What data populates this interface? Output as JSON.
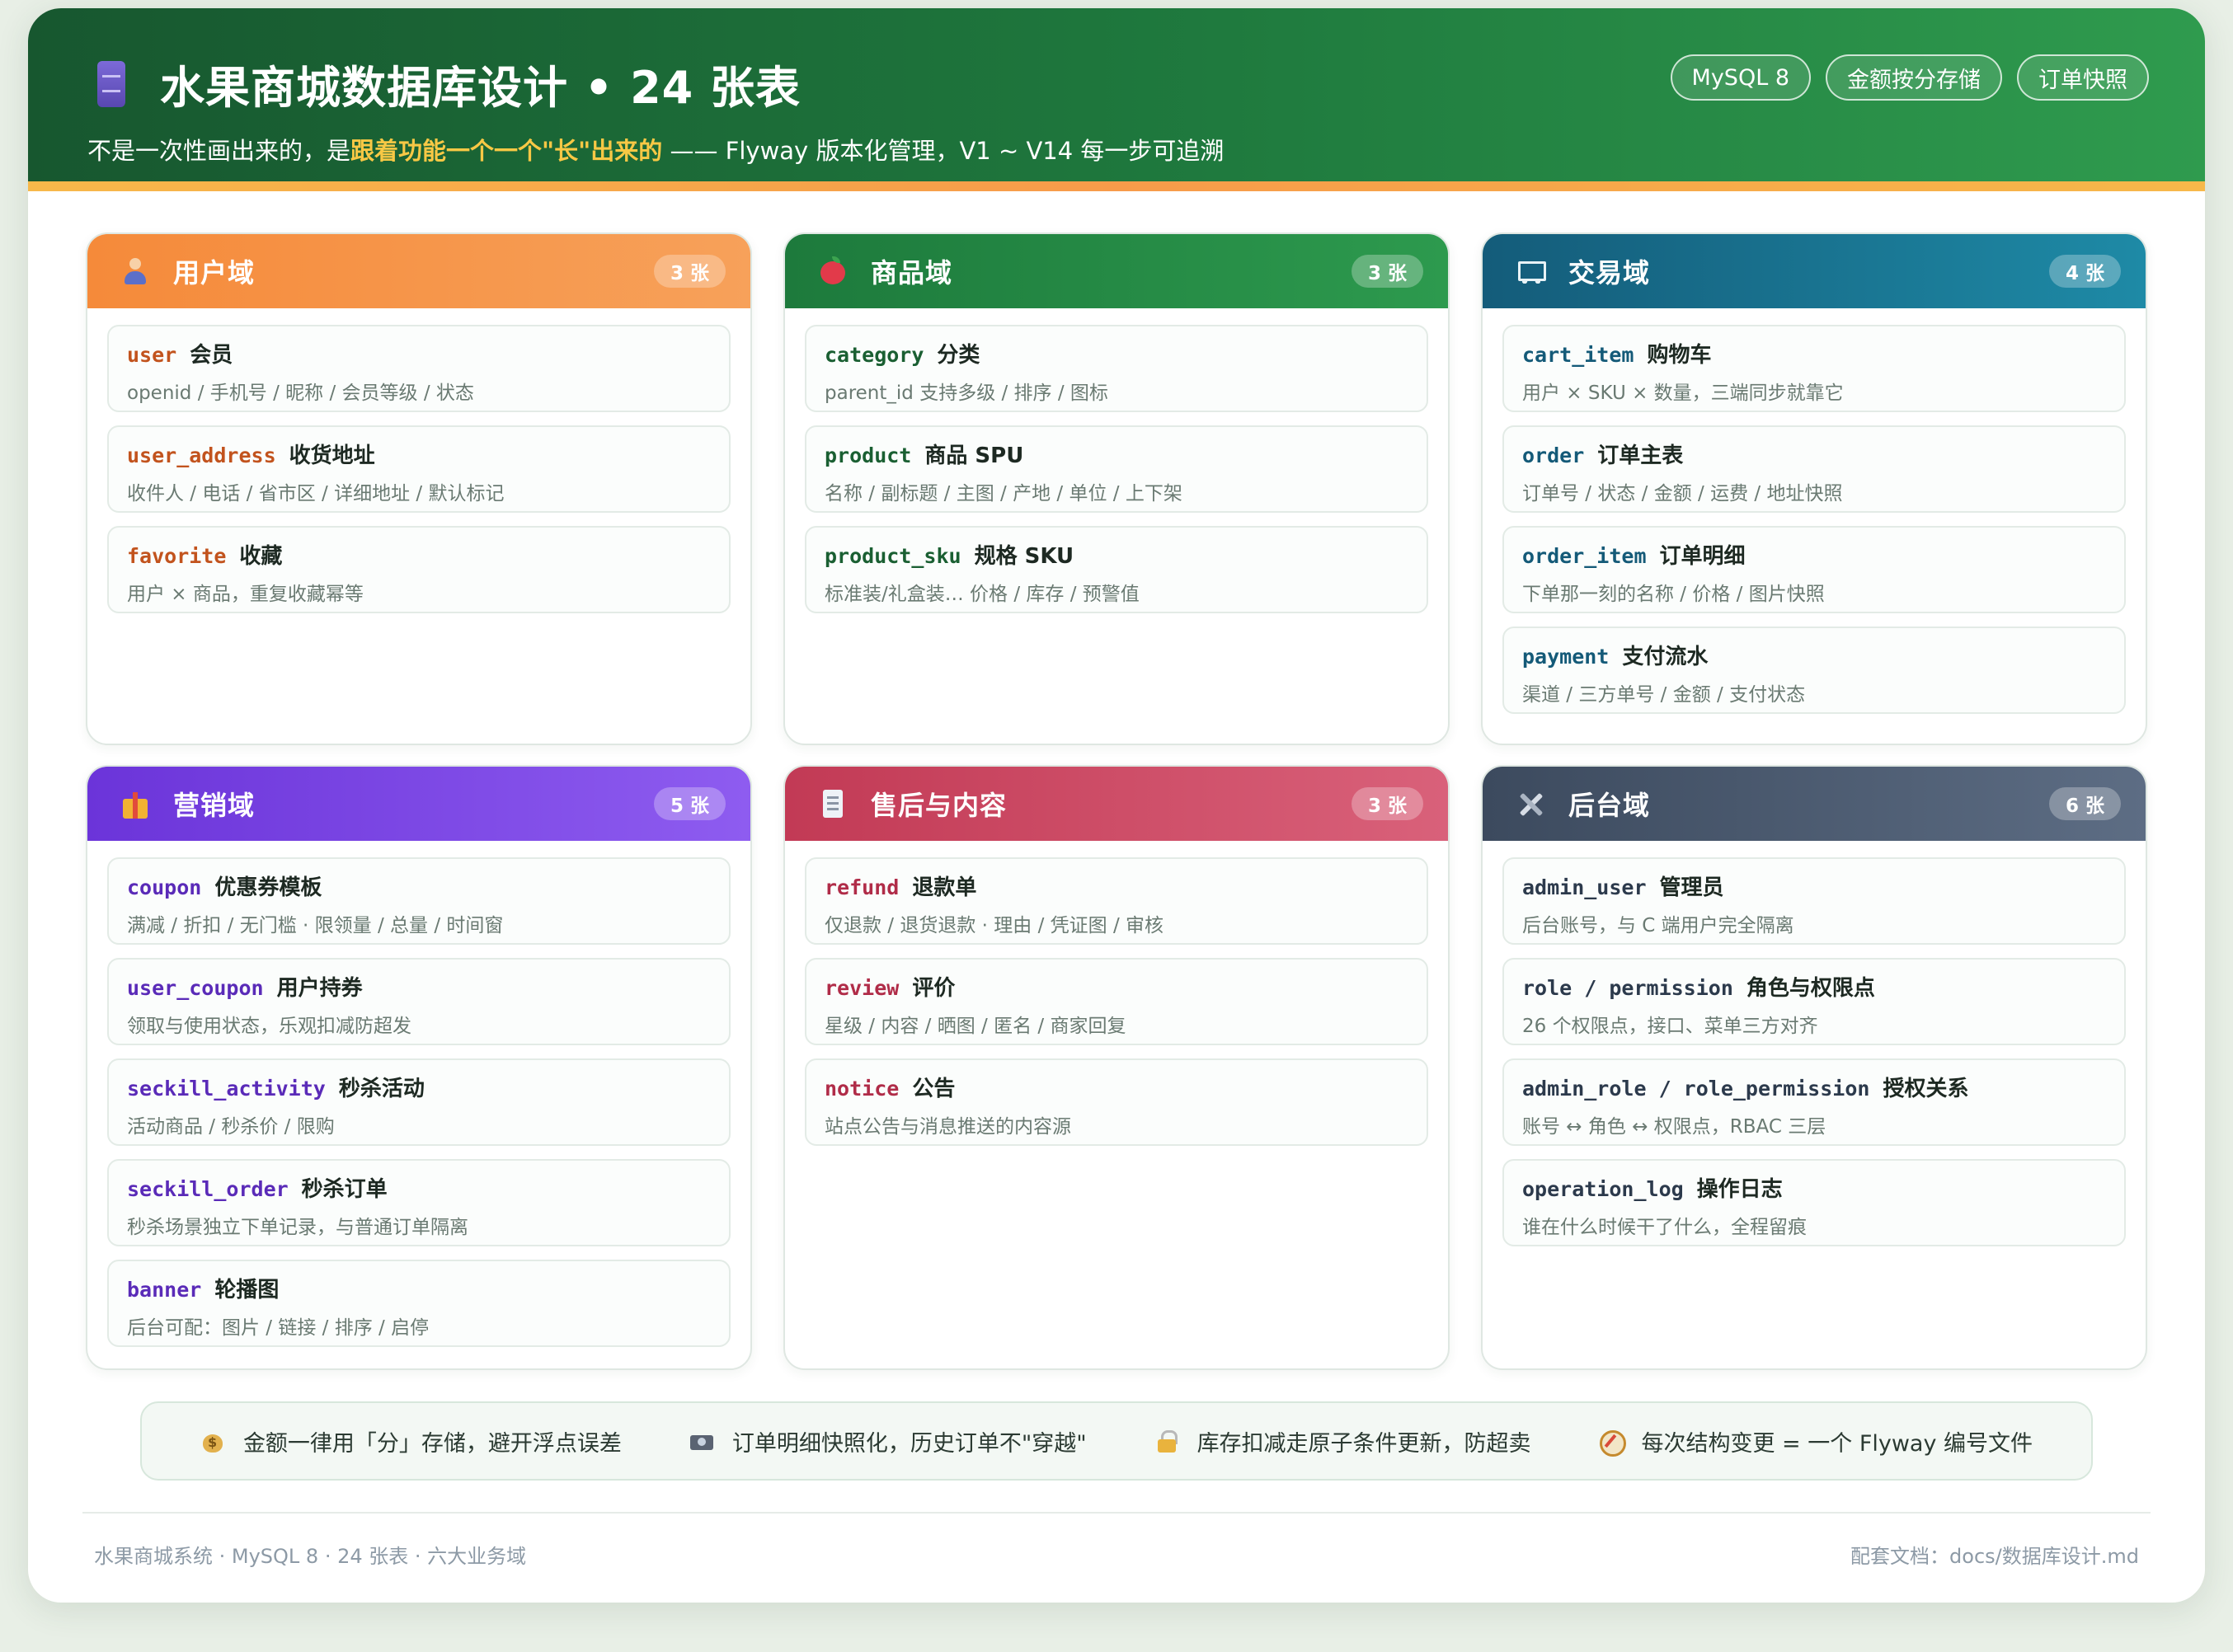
{
  "header": {
    "title": "水果商城数据库设计 • 24 张表",
    "subtitle_pre": "不是一次性画出来的，是",
    "subtitle_highlight": "跟着功能一个一个\"长\"出来的",
    "subtitle_post": " —— Flyway 版本化管理，V1 ~ V14 每一步可追溯",
    "tags": [
      "MySQL 8",
      "金额按分存储",
      "订单快照"
    ],
    "icon": "database-icon"
  },
  "colors": {
    "header_green": "#1f7a3e",
    "highlight_yellow": "#f8c845",
    "user_domain": "#f58a3a",
    "goods_domain": "#1d7a3c",
    "trade_domain": "#145c7a",
    "marketing_domain": "#6b34d9",
    "aftersale_domain": "#c23a55",
    "admin_domain": "#3c4a5e"
  },
  "domains": [
    {
      "title": "用户域",
      "count": "3 张",
      "icon": "user-icon",
      "tables": [
        {
          "code": "user",
          "name": "会员",
          "desc": "openid / 手机号 / 昵称 / 会员等级 / 状态"
        },
        {
          "code": "user_address",
          "name": "收货地址",
          "desc": "收件人 / 电话 / 省市区 / 详细地址 / 默认标记"
        },
        {
          "code": "favorite",
          "name": "收藏",
          "desc": "用户 × 商品，重复收藏幂等"
        }
      ]
    },
    {
      "title": "商品域",
      "count": "3 张",
      "icon": "apple-icon",
      "tables": [
        {
          "code": "category",
          "name": "分类",
          "desc": "parent_id 支持多级 / 排序 / 图标"
        },
        {
          "code": "product",
          "name": "商品 SPU",
          "desc": "名称 / 副标题 / 主图 / 产地 / 单位 / 上下架"
        },
        {
          "code": "product_sku",
          "name": "规格 SKU",
          "desc": "标准装/礼盒装… 价格 / 库存 / 预警值"
        }
      ]
    },
    {
      "title": "交易域",
      "count": "4 张",
      "icon": "cart-icon",
      "tables": [
        {
          "code": "cart_item",
          "name": "购物车",
          "desc": "用户 × SKU × 数量，三端同步就靠它"
        },
        {
          "code": "order",
          "name": "订单主表",
          "desc": "订单号 / 状态 / 金额 / 运费 / 地址快照"
        },
        {
          "code": "order_item",
          "name": "订单明细",
          "desc": "下单那一刻的名称 / 价格 / 图片快照"
        },
        {
          "code": "payment",
          "name": "支付流水",
          "desc": "渠道 / 三方单号 / 金额 / 支付状态"
        }
      ]
    },
    {
      "title": "营销域",
      "count": "5 张",
      "icon": "gift-icon",
      "tables": [
        {
          "code": "coupon",
          "name": "优惠券模板",
          "desc": "满减 / 折扣 / 无门槛 · 限领量 / 总量 / 时间窗"
        },
        {
          "code": "user_coupon",
          "name": "用户持券",
          "desc": "领取与使用状态，乐观扣减防超发"
        },
        {
          "code": "seckill_activity",
          "name": "秒杀活动",
          "desc": "活动商品 / 秒杀价 / 限购"
        },
        {
          "code": "seckill_order",
          "name": "秒杀订单",
          "desc": "秒杀场景独立下单记录，与普通订单隔离"
        },
        {
          "code": "banner",
          "name": "轮播图",
          "desc": "后台可配：图片 / 链接 / 排序 / 启停"
        }
      ]
    },
    {
      "title": "售后与内容",
      "count": "3 张",
      "icon": "document-icon",
      "tables": [
        {
          "code": "refund",
          "name": "退款单",
          "desc": "仅退款 / 退货退款 · 理由 / 凭证图 / 审核"
        },
        {
          "code": "review",
          "name": "评价",
          "desc": "星级 / 内容 / 晒图 / 匿名 / 商家回复"
        },
        {
          "code": "notice",
          "name": "公告",
          "desc": "站点公告与消息推送的内容源"
        }
      ]
    },
    {
      "title": "后台域",
      "count": "6 张",
      "icon": "tools-icon",
      "tables": [
        {
          "code": "admin_user",
          "name": "管理员",
          "desc": "后台账号，与 C 端用户完全隔离"
        },
        {
          "code": "role / permission",
          "name": "角色与权限点",
          "desc": "26 个权限点，接口、菜单三方对齐"
        },
        {
          "code": "admin_role / role_permission",
          "name": "授权关系",
          "desc": "账号 ↔ 角色 ↔ 权限点，RBAC 三层"
        },
        {
          "code": "operation_log",
          "name": "操作日志",
          "desc": "谁在什么时候干了什么，全程留痕"
        }
      ]
    }
  ],
  "tips": [
    {
      "icon": "money-bag-icon",
      "text": "金额一律用「分」存储，避开浮点误差"
    },
    {
      "icon": "camera-icon",
      "text": "订单明细快照化，历史订单不\"穿越\""
    },
    {
      "icon": "lock-icon",
      "text": "库存扣减走原子条件更新，防超卖"
    },
    {
      "icon": "compass-icon",
      "text": "每次结构变更 = 一个 Flyway 编号文件"
    }
  ],
  "footer": {
    "left": "水果商城系统 · MySQL 8 · 24 张表 · 六大业务域",
    "right": "配套文档：docs/数据库设计.md"
  }
}
